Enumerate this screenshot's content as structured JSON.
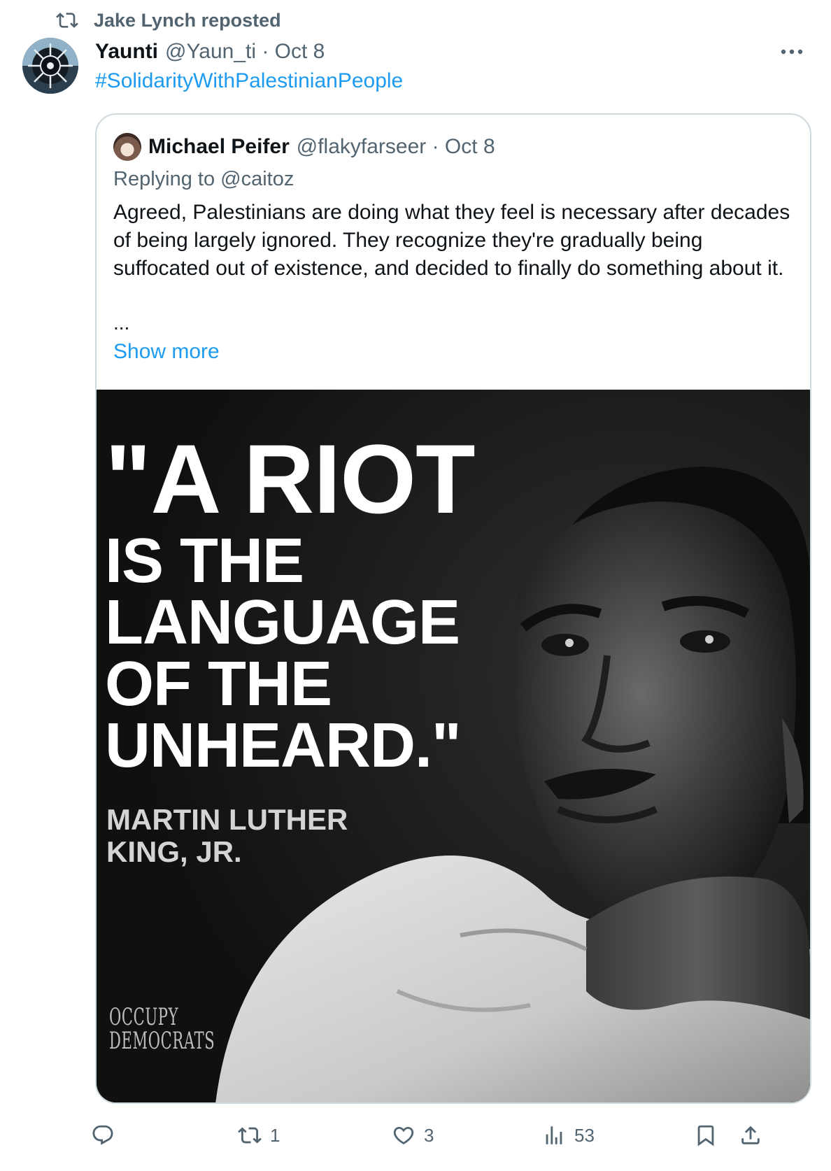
{
  "repost": {
    "label": "Jake Lynch reposted"
  },
  "tweet": {
    "author_name": "Yaunti",
    "meta": "@Yaun_ti · Oct 8",
    "hashtag": "#SolidarityWithPalestinianPeople"
  },
  "quote": {
    "author_name": "Michael Peifer",
    "meta": "@flakyfarseer · Oct 8",
    "replying_to": "Replying to @caitoz",
    "text": "Agreed, Palestinians are doing what they feel is necessary after decades of being largely ignored. They recognize they're gradually being suffocated out of existence, and decided to finally do something about it.",
    "ellipsis": "...",
    "show_more": "Show more",
    "image": {
      "quote_lines": [
        "\"A RIOT",
        "IS THE",
        "LANGUAGE",
        "OF THE",
        "UNHEARD.\""
      ],
      "attribution_lines": [
        "MARTIN LUTHER",
        "KING, JR."
      ],
      "brand_lines": [
        "OCCUPY",
        "DEMOCRATS"
      ]
    }
  },
  "actions": {
    "reply_count": "",
    "repost_count": "1",
    "like_count": "3",
    "views_count": "53"
  },
  "colors": {
    "accent": "#1d9bf0",
    "muted": "#536471",
    "border": "#cfd9de"
  },
  "icons": [
    "repost-icon",
    "more-icon",
    "reply-icon",
    "like-icon",
    "views-icon",
    "bookmark-icon",
    "share-icon"
  ]
}
